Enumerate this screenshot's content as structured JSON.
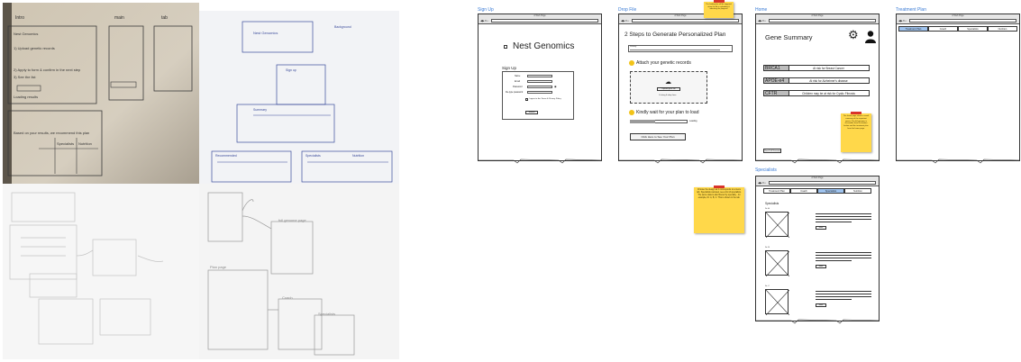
{
  "sketch_photos": {
    "top_left": {
      "col_headers": [
        "Intro",
        "main",
        "tab"
      ],
      "lines": [
        "Nest Genomics",
        "1) Upload genetic records",
        "2) Apply to form & confirm in the next step",
        "3) See the list",
        "Loading results",
        "Based on your results, we recommend this plan",
        "Specialists",
        "Nutrition"
      ]
    },
    "top_right": {
      "lines": [
        "Nest Genomics",
        "Background",
        "Sign up",
        "Summary",
        "Recommended",
        "Specialists",
        "Nutrition"
      ]
    },
    "bottom_right": {
      "lines": [
        "full genome page",
        "Plan page",
        "Coach",
        "Specialists"
      ]
    }
  },
  "wireframes": {
    "signup": {
      "section_label": "Sign Up",
      "window_title": "A Web Page",
      "brand": "Nest Genomics",
      "form_title": "Sign Up",
      "field_labels": [
        "Name",
        "Email",
        "Password",
        "Re-type password"
      ],
      "terms": "I agree to the Terms & Privacy Policy",
      "submit": "Submit"
    },
    "drop_file": {
      "section_label": "Drop File",
      "window_title": "A Web Page",
      "heading": "2 Steps to Generate Personalized Plan",
      "privacy_title": "Privacy",
      "step1": "Attach your genetic records",
      "upload_button": "Upload your file",
      "upload_hint": "Or drag & drop here",
      "step2": "Kindly wait for your plan to load",
      "loading": "Loading",
      "see_plan": "Click Here to See Your Plan",
      "note": "The loading bar will be triggered when the file is uploading & indicating the progress"
    },
    "home": {
      "section_label": "Home",
      "window_title": "A Web Page",
      "heading": "Gene Summary",
      "genes": [
        {
          "code": "BRCA1",
          "desc": "At risk for Breast Cancer"
        },
        {
          "code": "APOE-e4",
          "desc": "At risk for Alzheimer's disease"
        },
        {
          "code": "CFTR",
          "desc": "Children may be at risk for Cystic Fibrosis"
        }
      ],
      "full_genome_button": "View Full Genome",
      "note": "The home page shows a result summary of the important genes. The full genome is accessible from the bottom button and the treatment plan from the home page."
    },
    "treatment": {
      "section_label": "Treatment Plan",
      "window_title": "A Web Page",
      "tabs": [
        "Treatment Plan",
        "Coach",
        "Specialists",
        "Nutrition"
      ],
      "active_tab": 0
    },
    "specialists": {
      "section_label": "Specialists",
      "window_title": "A Web Page",
      "tabs": [
        "Treatment Plan",
        "Coach",
        "Specialists",
        "Nutrition"
      ],
      "active_tab": 2,
      "heading": "Specialists",
      "doctors": [
        "Dr. A",
        "Dr. B",
        "Dr. C"
      ],
      "more_button": "More",
      "note": "Choose the design as it corresponds to a menu tab. Specialists carousel, see a list of specialists. The same data is also filtered by specialty - for example, Dr. A, B, C. This is shown in the tab."
    }
  }
}
